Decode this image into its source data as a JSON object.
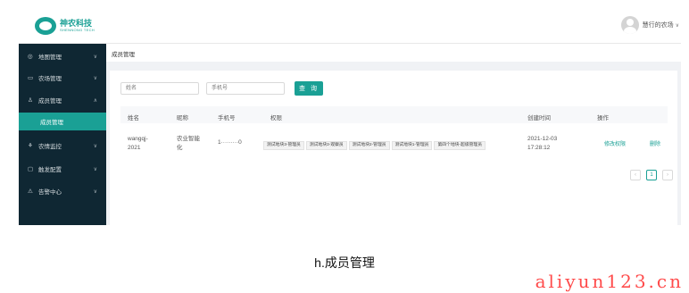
{
  "header": {
    "logo_title": "神农科技",
    "logo_sub": "SHENNONG TECH",
    "user_name": "慧行的农场",
    "user_caret": "∨"
  },
  "sidebar": {
    "items": [
      {
        "label": "地图管理",
        "icon": "◎",
        "icon_name": "map-icon",
        "arrow": "∨"
      },
      {
        "label": "农场管理",
        "icon": "▭",
        "icon_name": "farm-icon",
        "arrow": "∨"
      },
      {
        "label": "成员管理",
        "icon": "♙",
        "icon_name": "member-icon",
        "arrow": "∧"
      },
      {
        "label": "农情监控",
        "icon": "⚘",
        "icon_name": "monitor-icon",
        "arrow": "∨"
      },
      {
        "label": "触发配置",
        "icon": "▢",
        "icon_name": "trigger-icon",
        "arrow": "∨"
      },
      {
        "label": "告警中心",
        "icon": "⚠",
        "icon_name": "alert-icon",
        "arrow": "∨"
      }
    ],
    "active_subitem": "成员管理"
  },
  "breadcrumb": "成员管理",
  "search": {
    "name_placeholder": "姓名",
    "phone_placeholder": "手机号",
    "button_label": "查 询"
  },
  "table": {
    "columns": [
      "姓名",
      "昵称",
      "手机号",
      "权限",
      "创建时间",
      "操作"
    ],
    "rows": [
      {
        "name_line1": "wangqj-",
        "name_line2": "2021",
        "nickname_line1": "农业智能",
        "nickname_line2": "化",
        "phone": "1·········0",
        "permissions": [
          "测试地块3-管理员",
          "测试地块3-观察员",
          "测试地块2-管理员",
          "测试地块1-管理员",
          "第四个地块-超级管理员"
        ],
        "created_date": "2021-12-03",
        "created_time": "17:28:12",
        "op_edit": "修改权限",
        "op_delete": "删除"
      }
    ]
  },
  "pagination": {
    "prev": "‹",
    "current": "1",
    "next": "›"
  },
  "caption": "h.成员管理",
  "watermark": "aliyun123.cn",
  "colors": {
    "accent": "#1aa095",
    "sidebar_bg": "#0f2733",
    "watermark": "#ff4b4b"
  }
}
